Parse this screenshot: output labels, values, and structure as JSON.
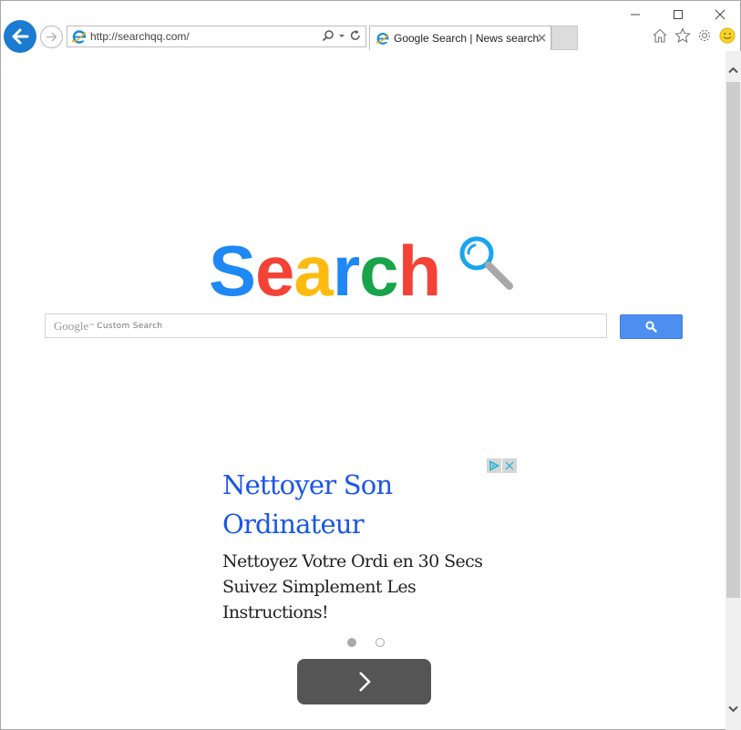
{
  "browser": {
    "address_url": "http://searchqq.com/",
    "tab_title": "Google Search | News search",
    "window_controls": [
      "minimize-icon",
      "maximize-icon",
      "close-icon"
    ],
    "toolbar_icons": [
      "home-icon",
      "favorites-star-icon",
      "gear-icon",
      "smiley-feedback-icon"
    ]
  },
  "logo": {
    "letters": [
      {
        "char": "S",
        "color": "#1e88f5"
      },
      {
        "char": "e",
        "color": "#f44336"
      },
      {
        "char": "a",
        "color": "#fdbb0f"
      },
      {
        "char": "r",
        "color": "#1e88f5"
      },
      {
        "char": "c",
        "color": "#19a34a"
      },
      {
        "char": "h",
        "color": "#f44336"
      }
    ],
    "magnifier_color": "#18a5f0",
    "handle_color": "#a8a8a8"
  },
  "search": {
    "brand": "Google",
    "tm": "™",
    "placeholder": "Custom Search",
    "button_color": "#4d8ff0"
  },
  "ad": {
    "title": "Nettoyer Son Ordinateur",
    "body": "Nettoyez Votre Ordi en 30 Secs Suivez Simplement Les Instructions!",
    "title_color": "#1a56e8",
    "pager": {
      "total": 2,
      "active": 1
    }
  }
}
